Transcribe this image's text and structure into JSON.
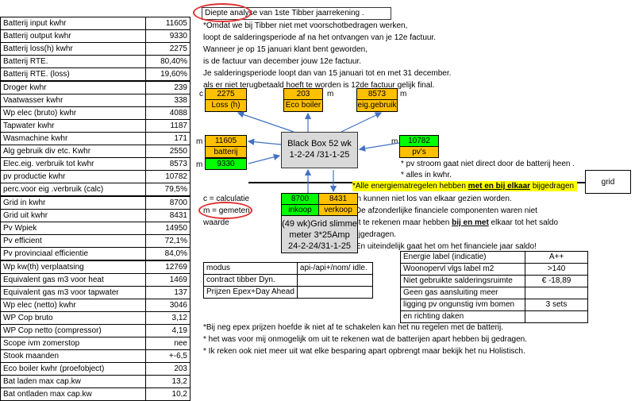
{
  "title": "Diepte analyse van 1ste Tibber jaarrekening .",
  "left_table": [
    {
      "label": "Batterij input  kwhr",
      "value": "11605"
    },
    {
      "label": "Batterij output  kwhr",
      "value": "9330"
    },
    {
      "label": "Batterij loss(h)  kwhr",
      "value": "2275"
    },
    {
      "label": "Batterij RTE.",
      "value": "80,40%"
    },
    {
      "label": "Batterij RTE. (loss)",
      "value": "19,60%"
    },
    {
      "label": "Droger  kwhr",
      "value": "239"
    },
    {
      "label": "Vaatwasser  kwhr",
      "value": "338"
    },
    {
      "label": "Wp elec (bruto)  kwhr",
      "value": "4088"
    },
    {
      "label": "Tapwater  kwhr",
      "value": "1187"
    },
    {
      "label": "Wasmachine  kwhr",
      "value": "171"
    },
    {
      "label": "Alg gebruik div etc.  Kwhr",
      "value": "2550"
    },
    {
      "label": "Elec.eig. verbruik tot kwhr",
      "value": "8573"
    },
    {
      "label": "pv productie   kwhr",
      "value": "10782"
    },
    {
      "label": "perc.voor eig .verbruik (calc)",
      "value": "79,5%"
    },
    {
      "label": "Grid in  kwhr",
      "value": "8700"
    },
    {
      "label": "Grid uit  kwhr",
      "value": "8431"
    },
    {
      "label": "Pv Wpiek",
      "value": "14950"
    },
    {
      "label": "Pv efficient",
      "value": "72,1%"
    },
    {
      "label": "Pv provinciaal efficientie",
      "value": "84,0%"
    },
    {
      "label": "Wp kw(th) verplaatsing",
      "value": "12769"
    },
    {
      "label": "Equivalent gas m3 voor heat",
      "value": "1469"
    },
    {
      "label": "Equivalent gas m3 voor tapwater",
      "value": "137"
    },
    {
      "label": "Wp elec (netto)  kwhr",
      "value": "3046"
    },
    {
      "label": "WP Cop bruto",
      "value": "3,12"
    },
    {
      "label": "WP Cop netto (compressor)",
      "value": "4,19"
    },
    {
      "label": "Scope ivm zomerstop",
      "value": "nee"
    },
    {
      "label": "Stook maanden",
      "value": "+-6,5"
    },
    {
      "label": "Eco boiler kwhr (proefobject)",
      "value": "203"
    },
    {
      "label": "Bat laden max cap.kw",
      "value": "13,2"
    },
    {
      "label": "Bat ontladen max cap.kw",
      "value": "10,2"
    }
  ],
  "notes_top": [
    "*Omdat we bij Tibber niet met voorschotbedragen werken,",
    "loopt de salderingsperiode af na het ontvangen van je 12e factuur.",
    "Wanneer je op 15 januari klant bent geworden,",
    " is de factuur van december jouw 12e factuur.",
    " Je salderingsperiode loopt dan van 15 januari tot en met 31 december.",
    "als er niet terugbetaald hoeft te worden is 12de factuur gelijk final."
  ],
  "diagram": {
    "c": "c",
    "m": "m",
    "loss_value": "2275",
    "loss_label": "Loss (h)",
    "eco_value": "203",
    "eco_label": "Eco boiler",
    "eig_value": "8573",
    "eig_label": "eig.gebruik",
    "bat_value": "11605",
    "bat_label": "batterij",
    "bat_out": "9330",
    "blackbox_l1": "Black Box 52 wk",
    "blackbox_l2": "1-2-24 /31-1-25",
    "pv_value": "10782",
    "pv_label": "pv's",
    "pv_note1": "* pv stroom gaat niet direct door de batterij heen .",
    "pv_note2": "* alles in  kwhr.",
    "grid_label": "grid",
    "inkoop_value": "8700",
    "verkoop_value": "8431",
    "inkoop_label": "inkoop",
    "verkoop_label": "verkoop",
    "meter_l1": "(49 wk)Grid slimme",
    "meter_l2": "meter 3*25Amp",
    "meter_l3": "24-2-24/31-1-25"
  },
  "legend": {
    "calc": "c = calculatie",
    "gemeten": "m = gemeten",
    "waarde": "waarde"
  },
  "notes_mid": {
    "n1_pre": "*Alle energiematregelen hebben ",
    "n1_bold": "met en bij elkaar",
    "n1_post": " bijgedragen",
    "n2": "en kunnen niet los van elkaar gezien worden.",
    "n3": "*De afzonderlijke financiele componenten waren niet",
    "n4_pre": "uit te rekenen maar hebben ",
    "n4_bold": "bij en met",
    "n4_post": " elkaar tot het saldo",
    "n5": "bijgedragen.",
    "n6": "*En uiteindelijk gaat het om het financiele jaar saldo!"
  },
  "modus_table": [
    {
      "k": "modus",
      "v": "api-/api+/nom/ idle."
    },
    {
      "k": "contract  tibber Dyn.",
      "v": ""
    },
    {
      "k": "Prijzen Epex+Day Ahead",
      "v": ""
    }
  ],
  "energy_table": [
    {
      "k": "Energie label  (indicatie)",
      "v": "A++"
    },
    {
      "k": "Woonopervl vlgs label m2",
      "v": ">140"
    },
    {
      "k": "Niet gebruikte salderingsruimte",
      "v": "€   -18,89"
    },
    {
      "k": "Geen gas aansluiting meer",
      "v": ""
    },
    {
      "k": "ligging pv ongunstig ivm bomen",
      "v": "3 sets"
    },
    {
      "k": "en richting daken",
      "v": ""
    }
  ],
  "notes_bottom": [
    "*Bij neg epex prijzen hoefde ik niet af te schakelen kan het nu regelen met de batterij.",
    "* het was voor mij onmogelijk om uit te rekenen wat de batterijen apart hebben bij gedragen.",
    "* Ik reken ook niet meer uit wat elke besparing apart opbrengt maar bekijk het nu Holistisch."
  ]
}
